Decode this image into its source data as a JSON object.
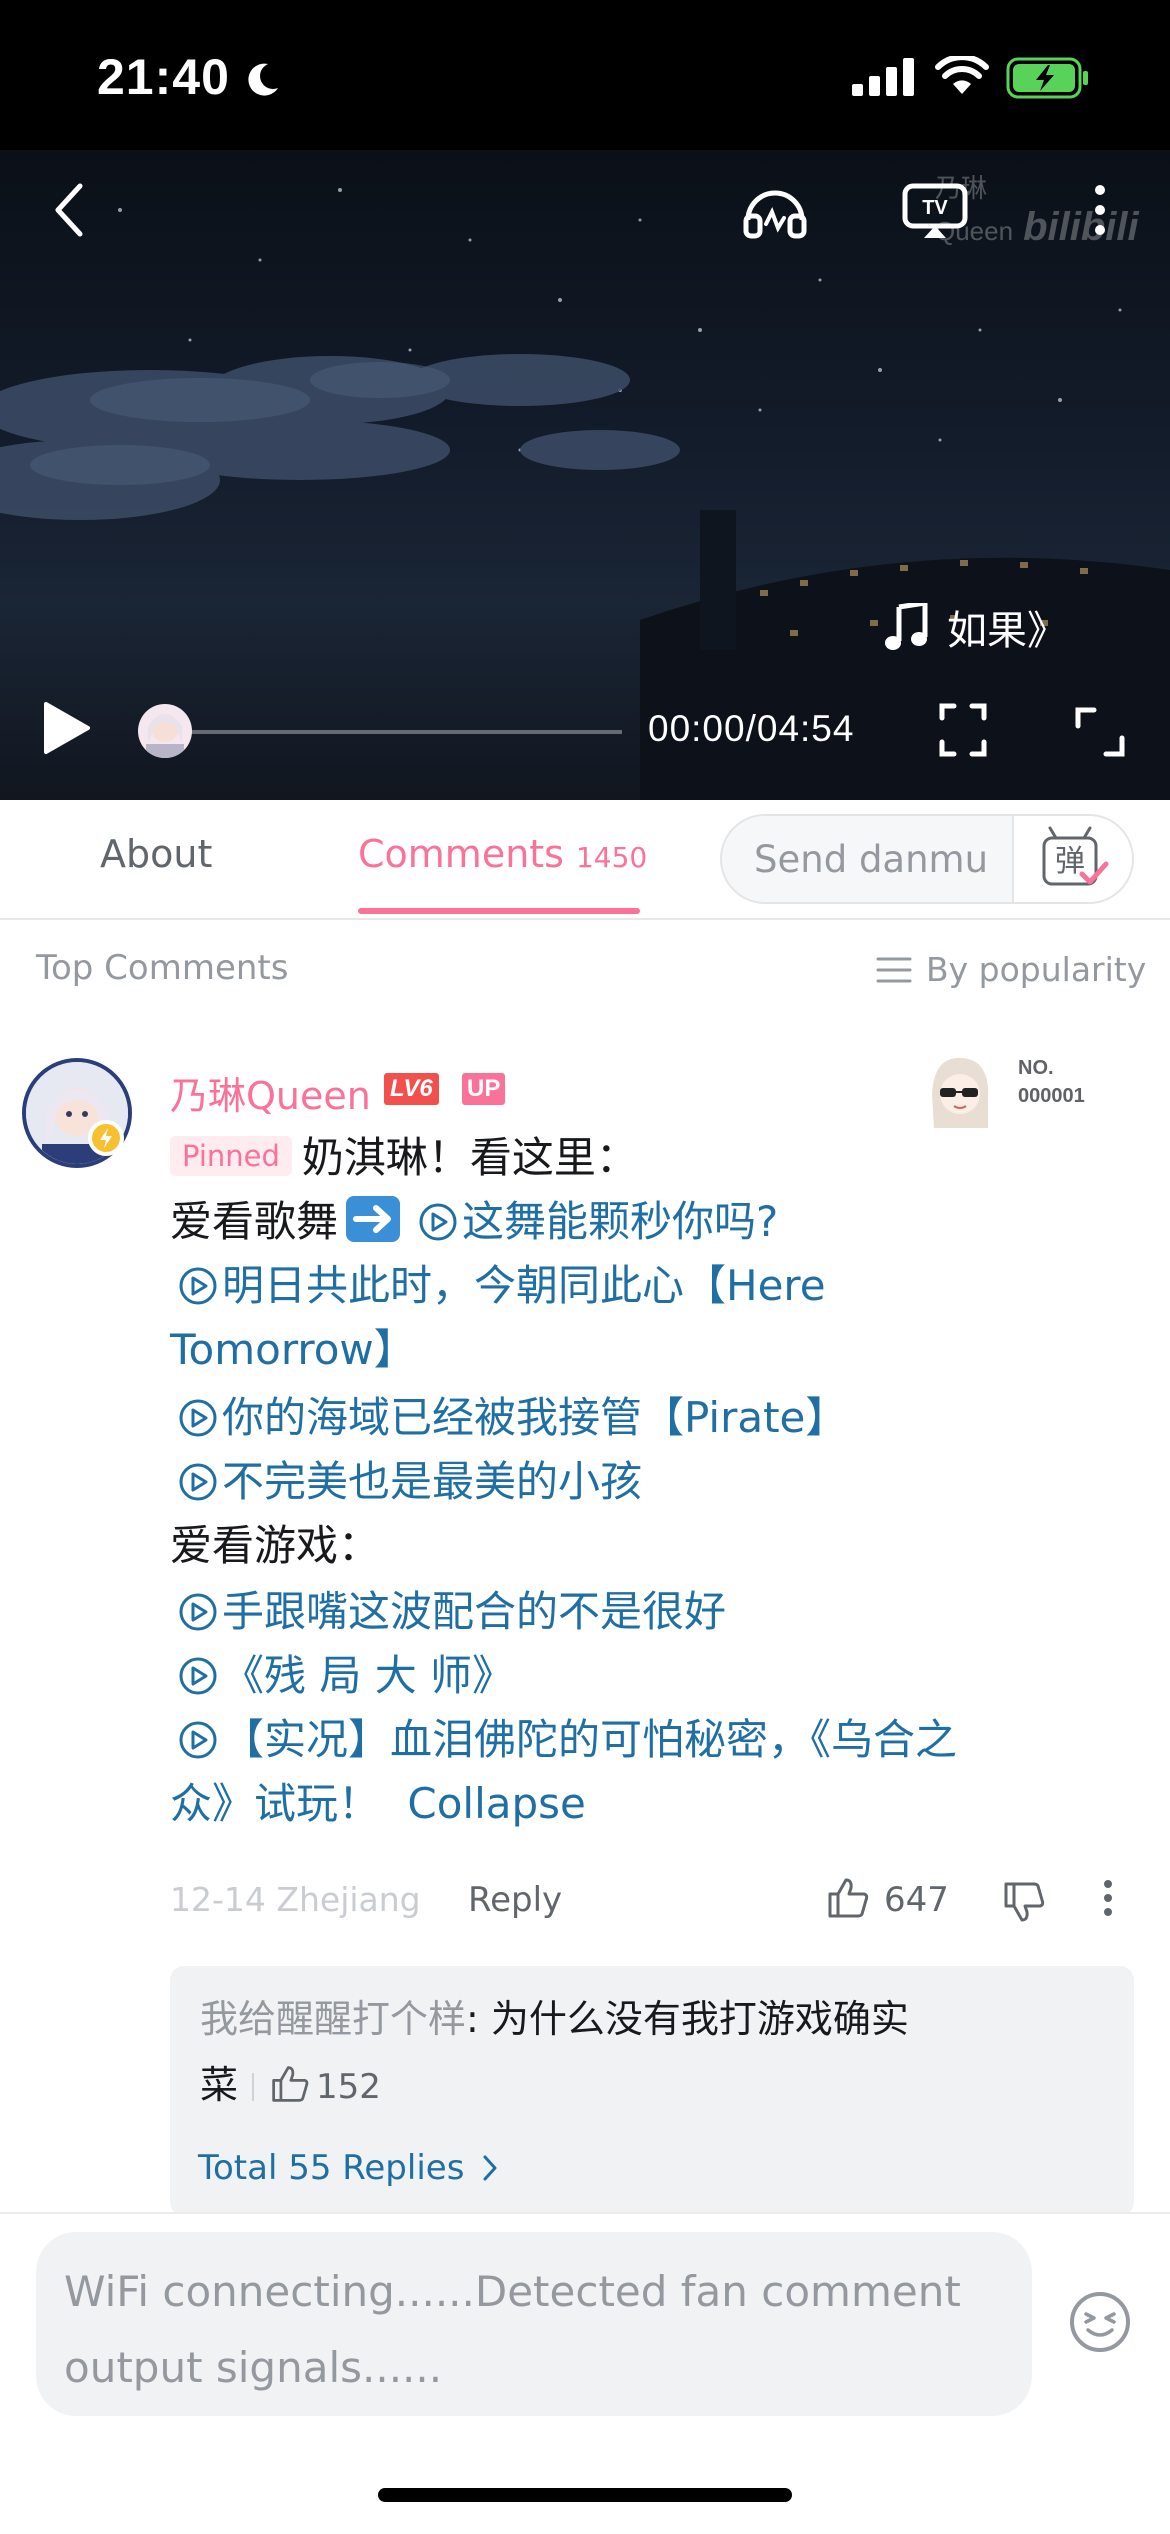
{
  "status_bar": {
    "time": "21:40",
    "icons": [
      "moon-icon",
      "cellular-signal-icon",
      "wifi-icon",
      "battery-charging-icon"
    ]
  },
  "player": {
    "watermark_user": "乃琳Queen",
    "watermark_brand": "bilibili",
    "song_title": "如果》",
    "time_display": "00:00/04:54",
    "progress": 0,
    "icons": [
      "back-icon",
      "headphone-icon",
      "tv-cast-icon",
      "more-vertical-icon",
      "play-icon",
      "fullscreen-icon",
      "expand-icon"
    ]
  },
  "tabs": {
    "about": "About",
    "comments": "Comments",
    "comments_count": "1450",
    "danmu_placeholder": "Send danmu",
    "danmu_button_glyph": "弹"
  },
  "comments_header": {
    "section": "Top Comments",
    "sort": "By popularity"
  },
  "comment": {
    "username": "乃琳Queen",
    "level_badge": "LV6",
    "up_badge": "UP",
    "fan_label_line1": "NO.",
    "fan_label_line2": "000001",
    "pinned": "Pinned",
    "line1": "奶淇琳！看这里：",
    "line2_prefix": "爱看歌舞",
    "link1": "这舞能颗秒你吗?",
    "link2a": "明日共此时，今朝同此心【Here",
    "link2b": "Tomorrow】",
    "link3": "你的海域已经被我接管【Pirate】",
    "link4": "不完美也是最美的小孩",
    "line_games": "爱看游戏：",
    "link5": "手跟嘴这波配合的不是很好",
    "link6": "《残 局 大 师》",
    "link7a": "【实况】血泪佛陀的可怕秘密，《乌合之",
    "link7b": "众》试玩！",
    "collapse": "Collapse",
    "date_location": "12-14 Zhejiang",
    "reply": "Reply",
    "likes": "647"
  },
  "replies": {
    "reply_user": "我给醒醒打个样",
    "reply_text_a": ": 为什么没有我打游戏确实",
    "reply_text_b": "菜",
    "reply_likes": "152",
    "total": "Total 55 Replies"
  },
  "bottom": {
    "placeholder": "WiFi connecting......Detected fan comment output signals......"
  },
  "colors": {
    "accent_pink": "#fb7299",
    "link_blue": "#1f6fa5",
    "text_gray": "#9499a0"
  }
}
